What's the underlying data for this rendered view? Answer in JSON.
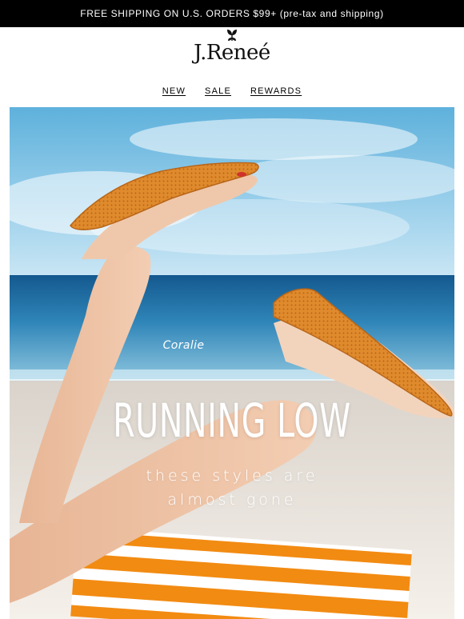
{
  "promo": {
    "text": "FREE SHIPPING ON U.S. ORDERS $99+ (pre-tax and shipping)"
  },
  "brand": {
    "logo_text": "J.Reneé",
    "logo_icon": "leaf-sprout-icon"
  },
  "nav": {
    "items": [
      {
        "label": "NEW"
      },
      {
        "label": "SALE"
      },
      {
        "label": "REWARDS"
      }
    ]
  },
  "hero": {
    "caption": "Coralie",
    "headline": "RUNNING LOW",
    "subline_1": "these styles are",
    "subline_2": "almost gone"
  },
  "colors": {
    "promo_bg": "#000000",
    "sky": "#6fb8de",
    "sea": "#1f6fa5",
    "sand": "#f1ebe4",
    "shoe": "#de8a2a",
    "towel_orange": "#f28b12"
  }
}
